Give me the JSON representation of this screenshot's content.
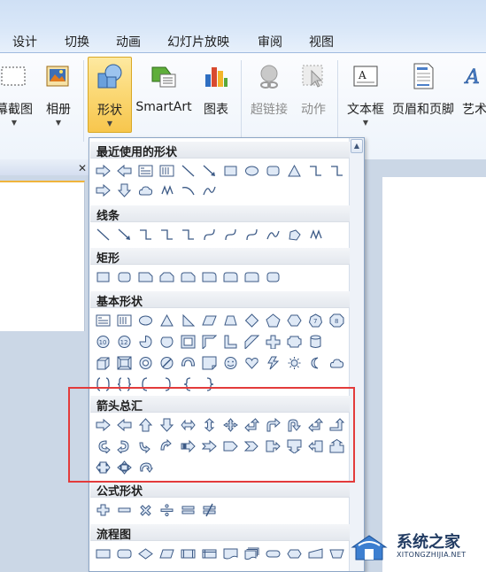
{
  "tabs": [
    {
      "label": "设计"
    },
    {
      "label": "切换"
    },
    {
      "label": "动画"
    },
    {
      "label": "幻灯片放映"
    },
    {
      "label": "审阅"
    },
    {
      "label": "视图"
    }
  ],
  "ribbon": {
    "screenshot_label": "幕截图",
    "album_label": "相册",
    "shapes_label": "形状",
    "smartart_label": "SmartArt",
    "chart_label": "图表",
    "hyperlink_label": "超链接",
    "action_label": "动作",
    "textbox_label": "文本框",
    "header_footer_label": "页眉和页脚",
    "wordart_label": "艺术"
  },
  "gallery": {
    "categories": [
      {
        "title": "最近使用的形状"
      },
      {
        "title": "线条"
      },
      {
        "title": "矩形"
      },
      {
        "title": "基本形状"
      },
      {
        "title": "箭头总汇"
      },
      {
        "title": "公式形状"
      },
      {
        "title": "流程图"
      }
    ]
  },
  "watermark": {
    "brand_cn": "系统之家",
    "brand_en": "XITONGZHIJIA.NET"
  },
  "colors": {
    "accent_active": "#f7c64d",
    "highlight_box": "#e33b3b",
    "shape_fill": "#dfe9f6",
    "shape_stroke": "#3c5a86"
  }
}
